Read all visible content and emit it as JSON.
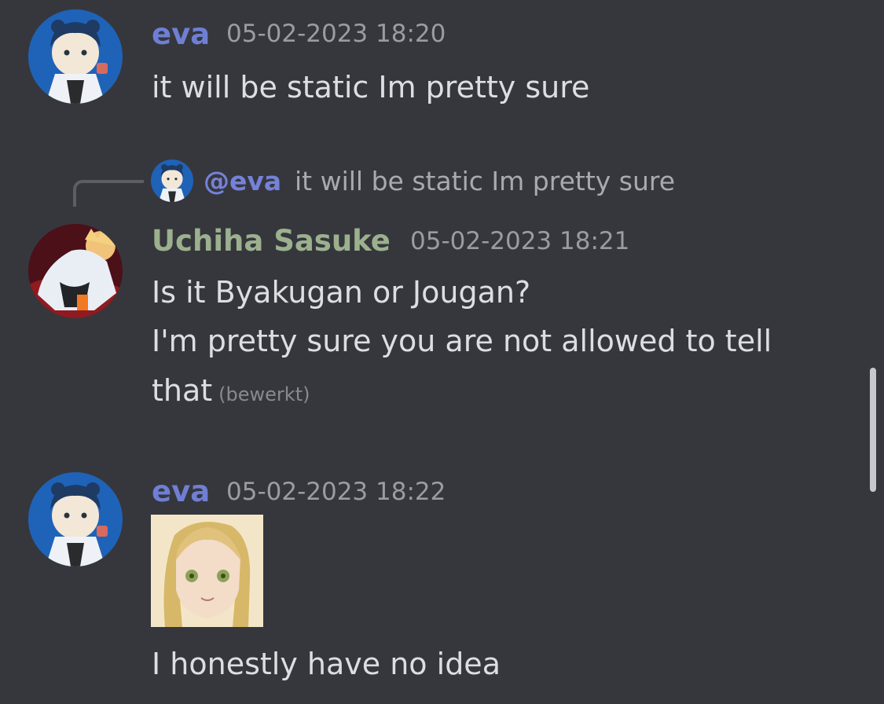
{
  "messages": [
    {
      "author": "eva",
      "timestamp": "05-02-2023 18:20",
      "avatar": "eva-avatar",
      "lines": [
        "it will be static Im pretty sure"
      ]
    },
    {
      "reply": {
        "mention": "@eva",
        "text": "it will be static Im pretty sure"
      },
      "author": "Uchiha Sasuke",
      "timestamp": "05-02-2023 18:21",
      "avatar": "uchiha-sasuke-avatar",
      "lines": [
        "Is it Byakugan or Jougan?",
        "I'm pretty sure you are not allowed to tell",
        "that"
      ],
      "edited_label": "(bewerkt)"
    },
    {
      "author": "eva",
      "timestamp": "05-02-2023 18:22",
      "avatar": "eva-avatar",
      "sticker": "anime-girl-sticker",
      "lines": [
        "I honestly have no idea"
      ]
    }
  ],
  "colors": {
    "background": "#36373d",
    "eva_name": "#6f7fd4",
    "sasuke_name": "#9cb08e",
    "timestamp": "#9a9ca2",
    "text": "#dcdee2"
  }
}
